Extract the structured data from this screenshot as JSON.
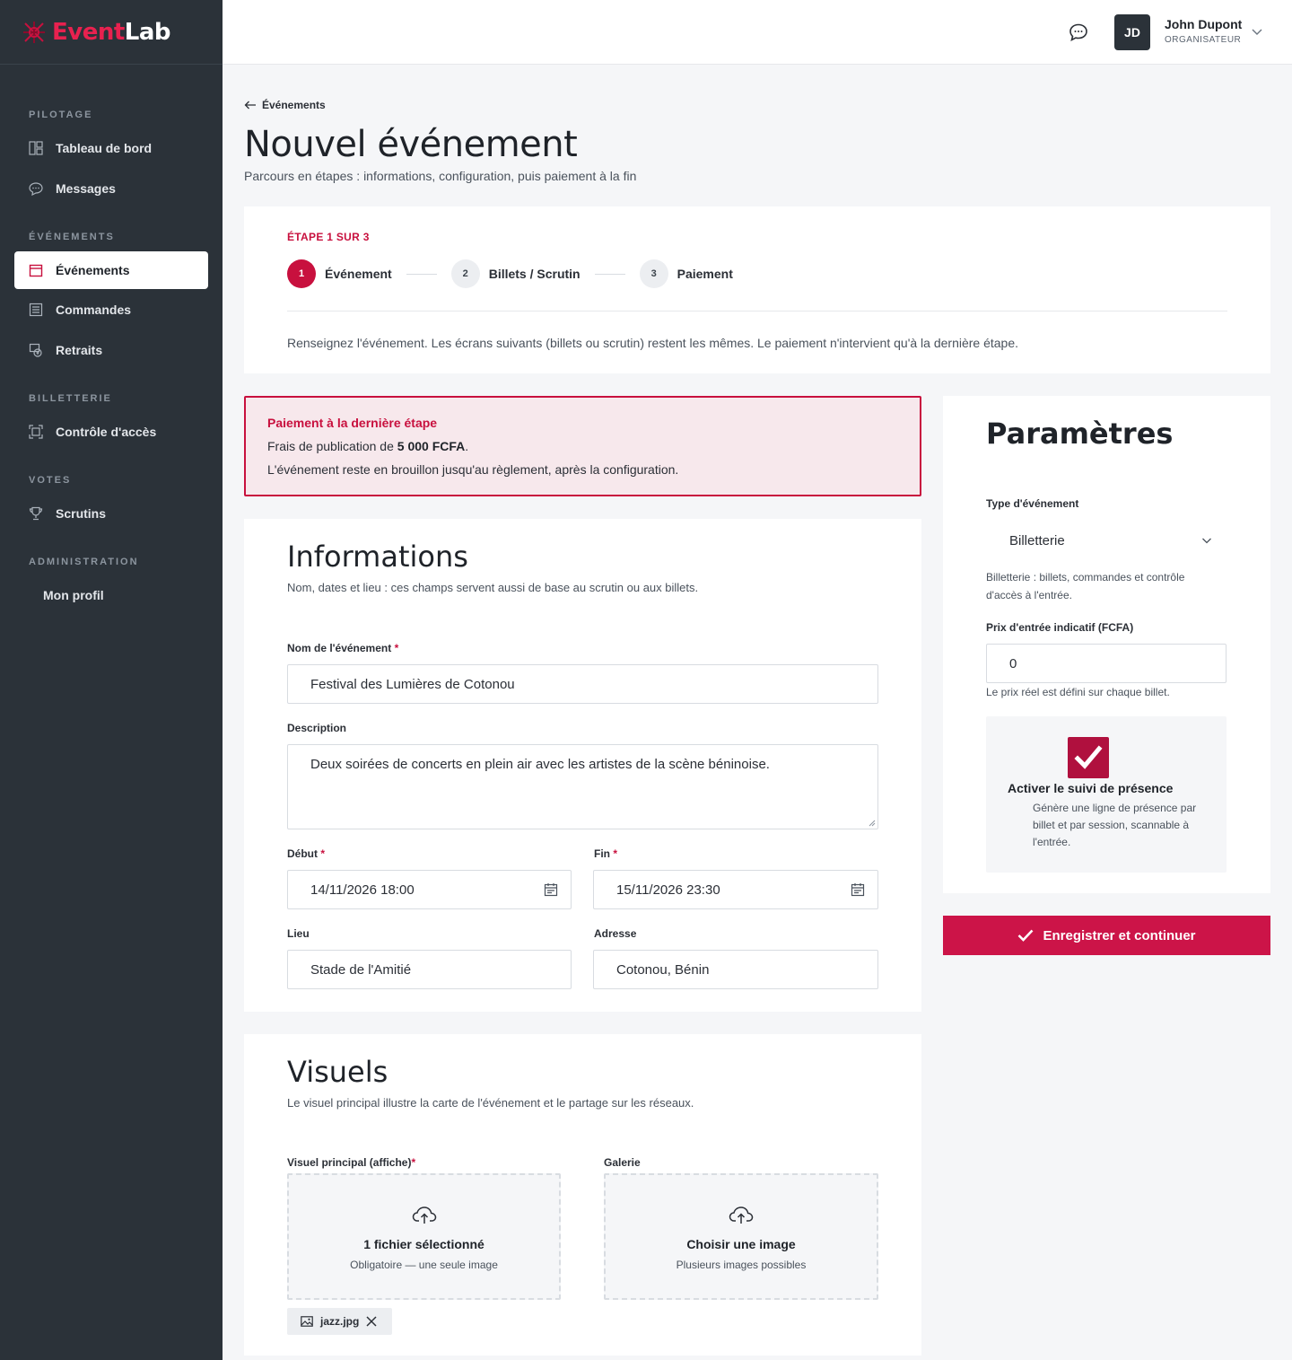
{
  "brand": {
    "name_part1": "Event",
    "name_part2": "Lab",
    "accent": "#c8103e"
  },
  "sidebar": {
    "sections": [
      {
        "label": "PILOTAGE"
      },
      {
        "label": "ÉVÉNEMENTS"
      },
      {
        "label": "BILLETTERIE"
      },
      {
        "label": "VOTES"
      },
      {
        "label": "ADMINISTRATION"
      }
    ],
    "items": [
      {
        "label": "Tableau de bord",
        "icon": "dashboard-icon"
      },
      {
        "label": "Messages",
        "icon": "chat-icon"
      },
      {
        "label": "Événements",
        "icon": "calendar-icon",
        "active": true
      },
      {
        "label": "Commandes",
        "icon": "list-icon"
      },
      {
        "label": "Retraits",
        "icon": "withdraw-icon"
      },
      {
        "label": "Contrôle d'accès",
        "icon": "scan-icon"
      },
      {
        "label": "Scrutins",
        "icon": "trophy-icon"
      },
      {
        "label": "Mon profil"
      }
    ]
  },
  "topbar": {
    "avatar_initials": "JD",
    "user_name": "John Dupont",
    "user_role": "ORGANISATEUR"
  },
  "page": {
    "back_label": "Événements",
    "title": "Nouvel événement",
    "subtitle": "Parcours en étapes : informations, configuration, puis paiement à la fin"
  },
  "stepper": {
    "label": "ÉTAPE 1 SUR 3",
    "steps": [
      {
        "num": "1",
        "label": "Événement",
        "active": true
      },
      {
        "num": "2",
        "label": "Billets / Scrutin"
      },
      {
        "num": "3",
        "label": "Paiement"
      }
    ],
    "note": "Renseignez l'événement. Les écrans suivants (billets ou scrutin) restent les mêmes. Le paiement n'intervient qu'à la dernière étape."
  },
  "alert": {
    "title": "Paiement à la dernière étape",
    "line1_prefix": "Frais de publication de ",
    "line1_amount": "5 000 FCFA",
    "line1_suffix": ".",
    "line2": "L'événement reste en brouillon jusqu'au règlement, après la configuration."
  },
  "informations": {
    "title": "Informations",
    "subtitle": "Nom, dates et lieu : ces champs servent aussi de base au scrutin ou aux billets.",
    "name_label": "Nom de l'événement",
    "name_value": "Festival des Lumières de Cotonou",
    "description_label": "Description",
    "description_value": "Deux soirées de concerts en plein air avec les artistes de la scène béninoise.",
    "start_label": "Début",
    "start_value": "14/11/2026 18:00",
    "end_label": "Fin",
    "end_value": "15/11/2026 23:30",
    "place_label": "Lieu",
    "place_value": "Stade de l'Amitié",
    "address_label": "Adresse",
    "address_value": "Cotonou, Bénin",
    "required_mark": "*"
  },
  "visuels": {
    "title": "Visuels",
    "subtitle": "Le visuel principal illustre la carte de l'événement et le partage sur les réseaux.",
    "main_label": "Visuel principal (affiche)",
    "main_title": "1 fichier sélectionné",
    "main_sub": "Obligatoire — une seule image",
    "gallery_label": "Galerie",
    "gallery_title": "Choisir une image",
    "gallery_sub": "Plusieurs images possibles",
    "file_name": "jazz.jpg"
  },
  "parametres": {
    "title": "Paramètres",
    "type_label": "Type d'événement",
    "type_value": "Billetterie",
    "type_help": "Billetterie : billets, commandes et contrôle d'accès à l'entrée.",
    "price_label": "Prix d'entrée indicatif (FCFA)",
    "price_value": "0",
    "price_help": "Le prix réel est défini sur chaque billet.",
    "attendance_title": "Activer le suivi de présence",
    "attendance_desc": "Génère une ligne de présence par billet et par session, scannable à l'entrée.",
    "attendance_checked": true
  },
  "actions": {
    "submit_label": "Enregistrer et continuer"
  }
}
